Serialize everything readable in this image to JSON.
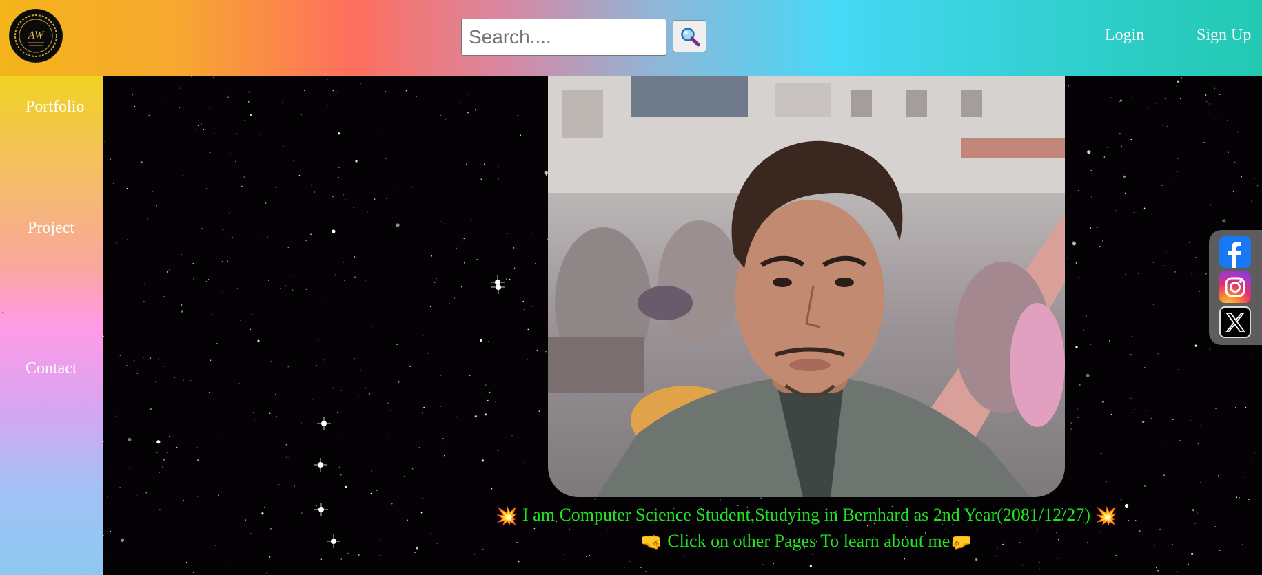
{
  "header": {
    "logo": {
      "icon": "aw-monogram-logo-icon",
      "monogram": "AW"
    },
    "search": {
      "placeholder": "Search....",
      "value": "",
      "button_icon": "magnifier-icon"
    },
    "nav": {
      "login": "Login",
      "signup": "Sign Up"
    }
  },
  "sidebar": {
    "items": [
      {
        "label": "Portfolio"
      },
      {
        "label": "Project"
      },
      {
        "label": "Contact"
      }
    ],
    "stray_char": "`"
  },
  "main": {
    "background": "starfield",
    "portrait_alt": "selfie portrait photo",
    "caption_line1": {
      "emoji": "💥",
      "text": " I am Computer Science Student,Studying in Bernhard as 2nd Year(2081/12/27) ",
      "emoji_end": "💥"
    },
    "caption_line2": {
      "emoji": "🤜",
      "text": " Click on other Pages To learn about me",
      "emoji_end": "🤛"
    }
  },
  "social": [
    {
      "icon": "facebook-icon"
    },
    {
      "icon": "instagram-icon"
    },
    {
      "icon": "x-twitter-icon"
    }
  ],
  "colors": {
    "caption": "#1fe51f",
    "nav_text": "#ffffff"
  }
}
